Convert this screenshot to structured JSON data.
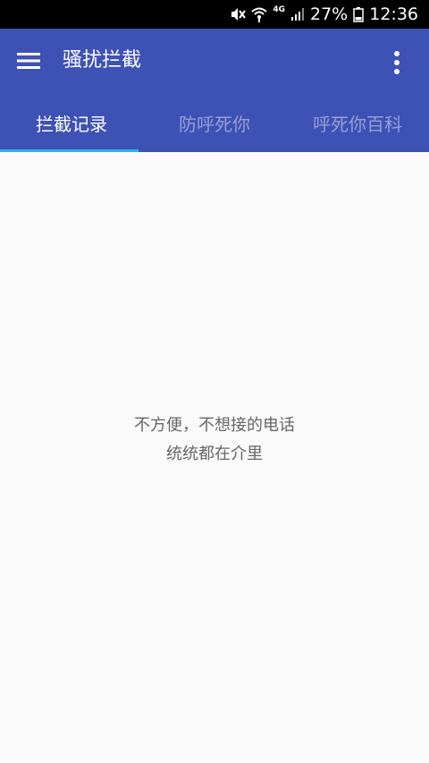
{
  "status_bar": {
    "network_label": "4G",
    "battery": "27%",
    "time": "12:36",
    "icons": [
      "mute-icon",
      "wifi-icon",
      "signal-icon",
      "battery-icon"
    ]
  },
  "app_bar": {
    "title": "骚扰拦截",
    "color": "#3e51b5",
    "menu_icon": "hamburger-menu-icon",
    "overflow_icon": "more-vertical-icon"
  },
  "tabs": [
    {
      "label": "拦截记录",
      "active": true
    },
    {
      "label": "防呼死你",
      "active": false
    },
    {
      "label": "呼死你百科",
      "active": false
    }
  ],
  "tab_indicator_color": "#29b6f6",
  "empty_state": {
    "line1": "不方便，不想接的电话",
    "line2": "统统都在介里"
  }
}
